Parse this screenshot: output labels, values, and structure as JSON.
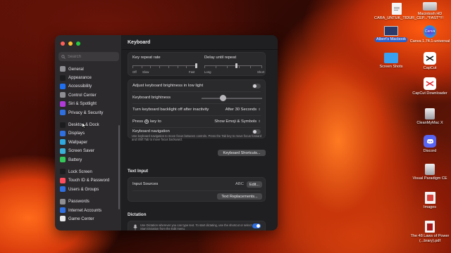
{
  "search": {
    "placeholder": "Search"
  },
  "sidebar": {
    "items": [
      {
        "label": "General",
        "icon": "gear-icon",
        "color": "#8e8e93"
      },
      {
        "label": "Appearance",
        "icon": "appearance-icon",
        "color": "#1c1c1e"
      },
      {
        "label": "Accessibility",
        "icon": "accessibility-icon",
        "color": "#1f6ff0"
      },
      {
        "label": "Control Center",
        "icon": "control-center-icon",
        "color": "#8e8e93"
      },
      {
        "label": "Siri & Spotlight",
        "icon": "siri-icon",
        "color": "#b23ad9"
      },
      {
        "label": "Privacy & Security",
        "icon": "hand-icon",
        "color": "#2f6fe0"
      },
      {
        "label": "Desktop & Dock",
        "icon": "dock-icon",
        "color": "#1c1c1e"
      },
      {
        "label": "Displays",
        "icon": "display-icon",
        "color": "#2f6fe0"
      },
      {
        "label": "Wallpaper",
        "icon": "wallpaper-icon",
        "color": "#2fa9e0"
      },
      {
        "label": "Screen Saver",
        "icon": "screen-saver-icon",
        "color": "#3ab0d8"
      },
      {
        "label": "Battery",
        "icon": "battery-icon",
        "color": "#34c759"
      },
      {
        "label": "Lock Screen",
        "icon": "lock-icon",
        "color": "#1c1c1e"
      },
      {
        "label": "Touch ID & Password",
        "icon": "fingerprint-icon",
        "color": "#ff4d5e"
      },
      {
        "label": "Users & Groups",
        "icon": "users-icon",
        "color": "#2f6fe0"
      },
      {
        "label": "Passwords",
        "icon": "key-icon",
        "color": "#8e8e93"
      },
      {
        "label": "Internet Accounts",
        "icon": "at-icon",
        "color": "#2f6fe0"
      },
      {
        "label": "Game Center",
        "icon": "game-center-icon",
        "color": "#e8e8ea"
      }
    ]
  },
  "main": {
    "title": "Keyboard",
    "key_repeat": {
      "label": "Key repeat rate",
      "ticks": {
        "off": "Off",
        "slow": "Slow",
        "fast": "Fast"
      },
      "value": 1.0
    },
    "delay_repeat": {
      "label": "Delay until repeat",
      "ticks": {
        "long": "Long",
        "short": "Short"
      },
      "value": 0.55
    },
    "adjust_brightness": {
      "label": "Adjust keyboard brightness in low light",
      "on": false
    },
    "keyboard_brightness": {
      "label": "Keyboard brightness",
      "value": 0.35
    },
    "backlight_off": {
      "label": "Turn keyboard backlight off after inactivity",
      "value": "After 30 Seconds"
    },
    "press_key": {
      "label_prefix": "Press",
      "label_suffix": "key to",
      "value": "Show Emoji & Symbols"
    },
    "keyboard_nav": {
      "label": "Keyboard navigation",
      "desc": "Use keyboard navigation to move focus between controls. Press the Tab key to move focus forward and Shift Tab to move focus backward.",
      "on": false
    },
    "shortcuts_button": "Keyboard Shortcuts...",
    "text_input": {
      "title": "Text Input",
      "sources_label": "Input Sources",
      "sources_value": "ABC",
      "edit_button": "Edit...",
      "replacements_button": "Text Replacements..."
    },
    "dictation": {
      "title": "Dictation",
      "desc": "Use Dictation wherever you can type text. To start dictating, use the shortcut or select Start Dictation from the Edit menu.",
      "on": true
    }
  },
  "desktop": {
    "items": [
      {
        "label": "CARA_UNTUK_TIDUR_CEP...*FAST*!!!",
        "icon": "document-icon"
      },
      {
        "label": "Macintosh HD",
        "icon": "hard-drive-icon"
      },
      {
        "label": "Albert's Macbook",
        "icon": "screenshot-icon",
        "selected": true
      },
      {
        "label": "Canva 1.74.1-universal",
        "icon": "canva-icon"
      },
      {
        "label": "Screen Shots",
        "icon": "folder-icon"
      },
      {
        "label": "CapCut",
        "icon": "capcut-icon"
      },
      {
        "label": "CapCut Downloader",
        "icon": "capcut-downloader-icon"
      },
      {
        "label": "CleanMyMac X",
        "icon": "cleanmymac-icon"
      },
      {
        "label": "Discord",
        "icon": "discord-icon"
      },
      {
        "label": "Visual Paradigm CE",
        "icon": "visual-paradigm-icon"
      },
      {
        "label": "Images",
        "icon": "images-icon"
      },
      {
        "label": "The 48 Laws of Power (...brary).pdf",
        "icon": "pdf-icon"
      }
    ]
  }
}
